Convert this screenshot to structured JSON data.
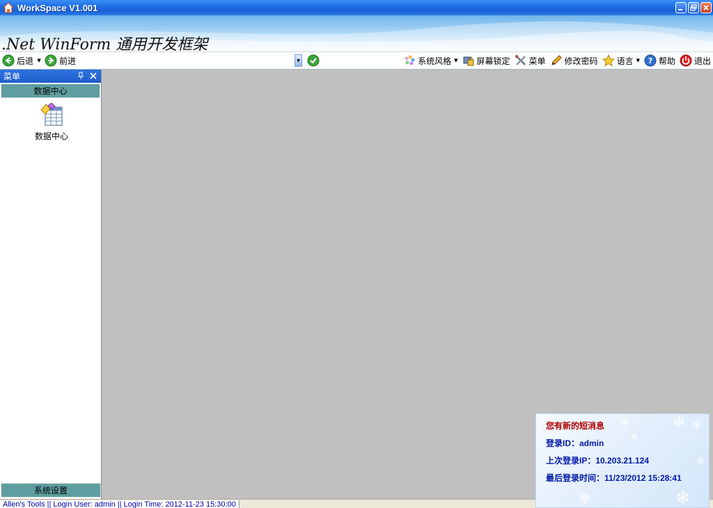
{
  "window": {
    "title": "WorkSpace  V1.001",
    "icons": {
      "app": "house-icon",
      "minimize": "minimize-icon",
      "restore": "restore-icon",
      "close": "close-icon"
    }
  },
  "banner": {
    "title": ".Net WinForm 通用开发框架"
  },
  "toolbar": {
    "back": "后退",
    "forward": "前进",
    "address_value": "",
    "right_items": [
      {
        "label": "系统风格",
        "icon": "palette-icon",
        "has_dropdown": true
      },
      {
        "label": "屏幕锁定",
        "icon": "lock-screen-icon",
        "has_dropdown": false
      },
      {
        "label": "菜单",
        "icon": "tools-icon",
        "has_dropdown": false
      },
      {
        "label": "修改密码",
        "icon": "pencil-icon",
        "has_dropdown": false
      },
      {
        "label": "语言",
        "icon": "star-icon",
        "has_dropdown": true
      },
      {
        "label": "帮助",
        "icon": "help-icon",
        "has_dropdown": false
      },
      {
        "label": "退出",
        "icon": "exit-icon",
        "has_dropdown": false
      }
    ]
  },
  "menu": {
    "header": "菜单",
    "group_top": "数据中心",
    "shortcut_label": "数据中心",
    "group_bottom": "系统设置"
  },
  "statusbar": {
    "text": "Allen's Tools  ||  Login User: admin  ||  Login Time: 2012-11-23 15:30:00"
  },
  "notification": {
    "heading": "您有新的短消息",
    "login_id": "登录ID：admin",
    "last_ip": "上次登录IP：10.203.21.124",
    "last_time": "最后登录时间：11/23/2012 15:28:41"
  },
  "colors": {
    "titlebar": "#1f6fe6",
    "group_header": "#5f9ea0",
    "workspace": "#c0c0c0",
    "notify_text": "#0018a8",
    "notify_head": "#b00000"
  }
}
